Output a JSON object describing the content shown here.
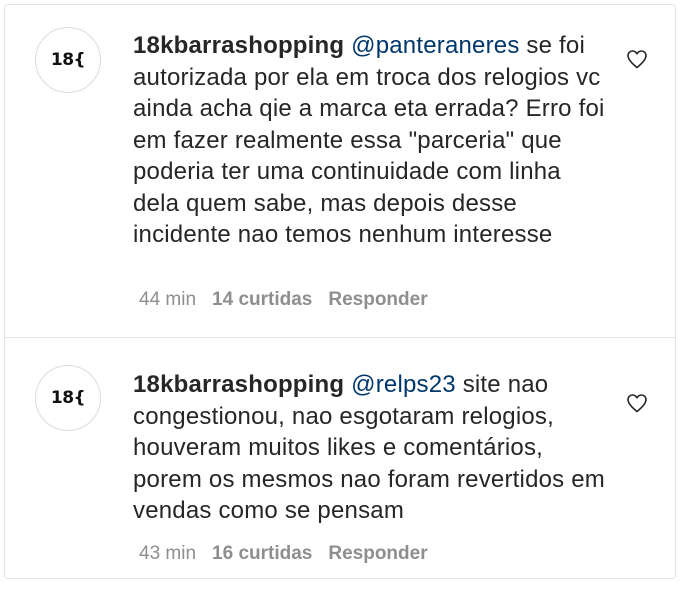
{
  "comments": [
    {
      "avatar_text": "18{",
      "username": "18kbarrashopping",
      "mention": "@panteraneres",
      "text": " se foi autorizada por ela em troca dos relogios vc ainda acha qie a marca eta errada? Erro foi em fazer realmente essa \"parceria\" que poderia ter uma continuidade com linha dela quem sabe, mas depois desse incidente nao temos nenhum interesse",
      "time": "44 min",
      "likes": "14 curtidas",
      "reply": "Responder",
      "icon": "heart-outline-icon"
    },
    {
      "avatar_text": "18{",
      "username": "18kbarrashopping",
      "mention": "@relps23",
      "text": " site nao congestionou, nao esgotaram relogios, houveram muitos likes e comentários, porem os mesmos nao foram revertidos em vendas como se pensam",
      "time": "43 min",
      "likes": "16 curtidas",
      "reply": "Responder",
      "icon": "heart-outline-icon"
    }
  ],
  "colors": {
    "text": "#262626",
    "mention": "#00376b",
    "meta": "#8e8e8e",
    "border": "#e6e6e6"
  }
}
